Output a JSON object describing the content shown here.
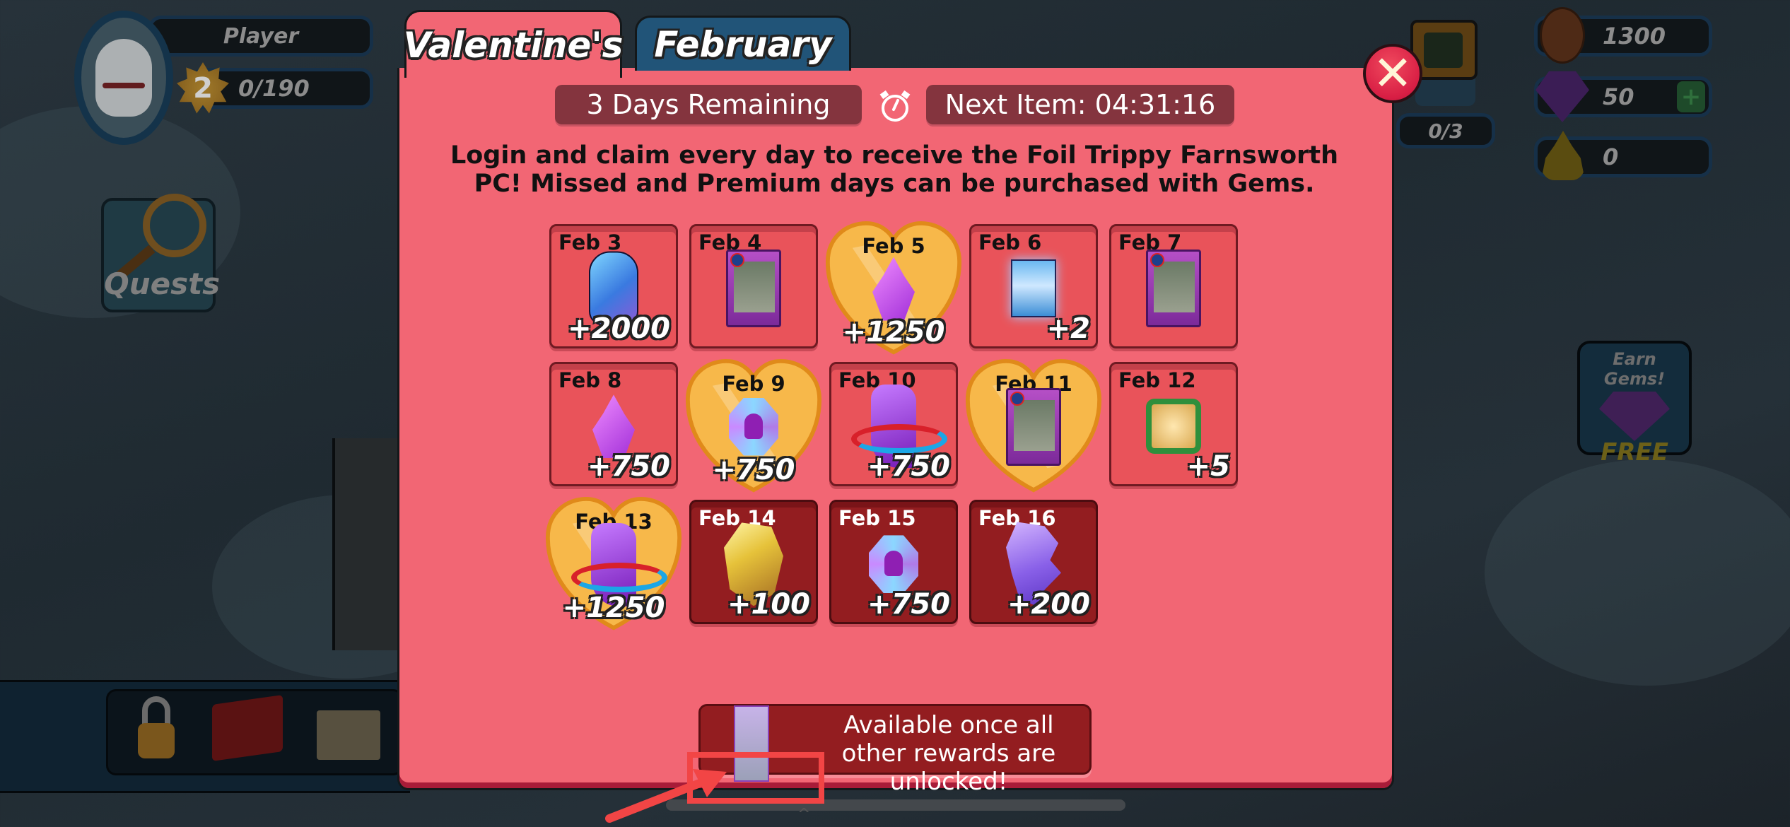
{
  "hud": {
    "player_name": "Player",
    "level": "2",
    "xp": "0/190",
    "quests_label": "Quests",
    "tv_count": "0/3",
    "coins": "1300",
    "gems": "50",
    "gems_add": "+",
    "poop": "0",
    "earn_gems_top": "Earn Gems!",
    "earn_gems_bottom": "FREE"
  },
  "modal": {
    "tabs": [
      {
        "label": "Valentine's",
        "active": true
      },
      {
        "label": "February",
        "active": false
      }
    ],
    "days_remaining": "3 Days Remaining",
    "next_item": "Next Item: 04:31:16",
    "description": "Login and claim every day to receive the Foil Trippy Farnsworth PC! Missed and Premium days can be purchased with Gems.",
    "close_label": "✕",
    "rewards": [
      {
        "date": "Feb 3",
        "item": "blue-crystal",
        "qty": "+2000",
        "state": "claimable",
        "premium": false
      },
      {
        "date": "Feb 4",
        "item": "trippy-farnsworth-card",
        "qty": "",
        "state": "claimable",
        "premium": false
      },
      {
        "date": "Feb 5",
        "item": "purple-crystal",
        "qty": "+1250",
        "state": "claimable",
        "premium": true
      },
      {
        "date": "Feb 6",
        "item": "card-pack",
        "qty": "+2",
        "state": "claimable",
        "premium": false
      },
      {
        "date": "Feb 7",
        "item": "trippy-farnsworth-card",
        "qty": "",
        "state": "claimable",
        "premium": false
      },
      {
        "date": "Feb 8",
        "item": "purple-crystal",
        "qty": "+750",
        "state": "claimable",
        "premium": false
      },
      {
        "date": "Feb 9",
        "item": "character-token",
        "qty": "+750",
        "state": "claimable",
        "premium": true
      },
      {
        "date": "Feb 10",
        "item": "mythic-shard",
        "qty": "+750",
        "state": "claimable",
        "premium": false
      },
      {
        "date": "Feb 11",
        "item": "trippy-farnsworth-card",
        "qty": "",
        "state": "claimable",
        "premium": true
      },
      {
        "date": "Feb 12",
        "item": "character-badge",
        "qty": "+5",
        "state": "claimable",
        "premium": false
      },
      {
        "date": "Feb 13",
        "item": "mythic-shard",
        "qty": "+1250",
        "state": "claimable",
        "premium": true
      },
      {
        "date": "Feb 14",
        "item": "yellow-gem",
        "qty": "+100",
        "state": "future",
        "premium": false
      },
      {
        "date": "Feb 15",
        "item": "character-token",
        "qty": "+750",
        "state": "future",
        "premium": false
      },
      {
        "date": "Feb 16",
        "item": "violet-rock",
        "qty": "+200",
        "state": "future",
        "premium": false
      }
    ],
    "final_reward": {
      "item": "foil-trippy-farnsworth-card",
      "text": "Available once all other rewards are unlocked!"
    }
  },
  "colors": {
    "modal_bg": "#f26674",
    "tile_claimable": "#e9535a",
    "tile_future": "#931d20",
    "pill_bg": "#84343e",
    "tab_inactive": "#215478",
    "annotation": "#f24545"
  }
}
